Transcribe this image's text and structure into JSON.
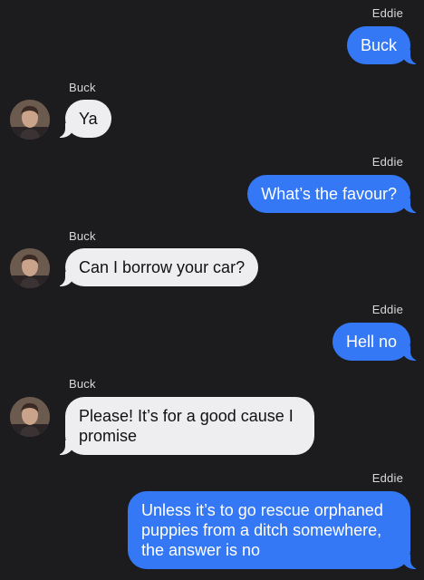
{
  "messages": [
    {
      "sender": "Eddie",
      "direction": "outgoing",
      "text": "Buck"
    },
    {
      "sender": "Buck",
      "direction": "incoming",
      "text": "Ya"
    },
    {
      "sender": "Eddie",
      "direction": "outgoing",
      "text": "What’s the favour?"
    },
    {
      "sender": "Buck",
      "direction": "incoming",
      "text": "Can I borrow your car?"
    },
    {
      "sender": "Eddie",
      "direction": "outgoing",
      "text": "Hell no"
    },
    {
      "sender": "Buck",
      "direction": "incoming",
      "text": "Please! It’s for a good cause I promise"
    },
    {
      "sender": "Eddie",
      "direction": "outgoing",
      "text": "Unless it’s to go rescue orphaned puppies from a ditch somewhere, the answer is no"
    }
  ],
  "colors": {
    "background": "#1c1c1e",
    "outgoing_bubble": "#3478f6",
    "incoming_bubble": "#eeeef0",
    "sender_name": "#d8d8dc"
  },
  "avatar_icon": "profile-photo-icon"
}
